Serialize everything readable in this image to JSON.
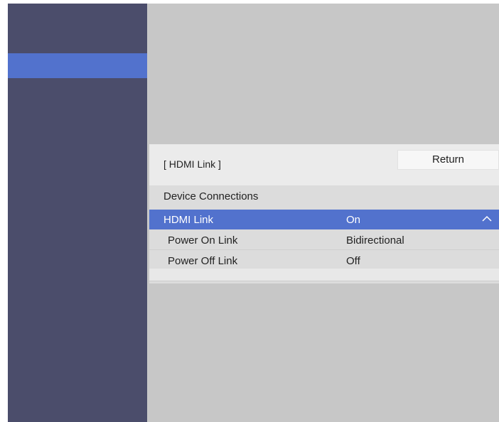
{
  "panel": {
    "title": "[ HDMI Link ]",
    "return_label": "Return",
    "section_label": "Device Connections",
    "rows": [
      {
        "label": "HDMI Link",
        "value": "On",
        "selected": true,
        "icon": "chevron-up-icon"
      },
      {
        "label": "Power On Link",
        "value": "Bidirectional",
        "selected": false
      },
      {
        "label": "Power Off Link",
        "value": "Off",
        "selected": false
      }
    ]
  },
  "colors": {
    "sidebar": "#4b4d6b",
    "selection": "#5272cd",
    "background": "#c7c7c7",
    "panel": "#dcdcdc"
  }
}
